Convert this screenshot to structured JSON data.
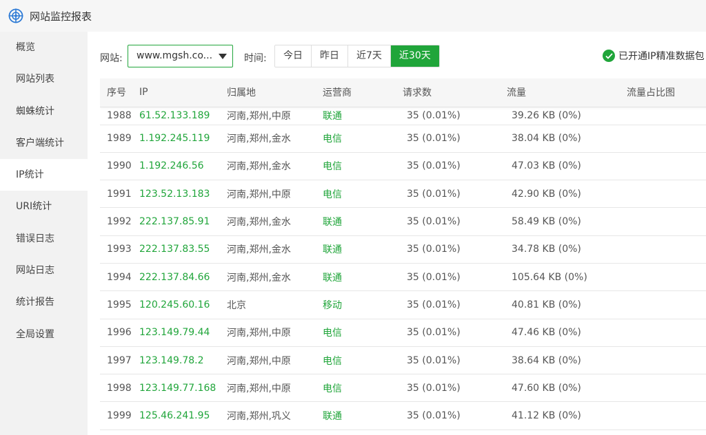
{
  "app": {
    "title": "网站监控报表",
    "logo_icon": "target-globe-icon",
    "accent": "#20a53a"
  },
  "sidebar": {
    "items": [
      {
        "label": "概览",
        "active": false
      },
      {
        "label": "网站列表",
        "active": false
      },
      {
        "label": "蜘蛛统计",
        "active": false
      },
      {
        "label": "客户端统计",
        "active": false
      },
      {
        "label": "IP统计",
        "active": true
      },
      {
        "label": "URI统计",
        "active": false
      },
      {
        "label": "错误日志",
        "active": false
      },
      {
        "label": "网站日志",
        "active": false
      },
      {
        "label": "统计报告",
        "active": false
      },
      {
        "label": "全局设置",
        "active": false
      }
    ]
  },
  "filters": {
    "site_label": "网站:",
    "site_value": "www.mgsh.co...",
    "time_label": "时间:",
    "time_options": [
      "今日",
      "昨日",
      "近7天",
      "近30天"
    ],
    "time_selected": "近30天",
    "ip_pack_text": "已开通IP精准数据包"
  },
  "table": {
    "columns": [
      "序号",
      "IP",
      "归属地",
      "运营商",
      "请求数",
      "流量",
      "流量占比图"
    ],
    "rows": [
      {
        "no": "1988",
        "ip": "61.52.133.189",
        "loc": "河南,郑州,中原",
        "isp": "联通",
        "req": "35 (0.01%)",
        "traffic": "39.26 KB (0%)"
      },
      {
        "no": "1989",
        "ip": "1.192.245.119",
        "loc": "河南,郑州,金水",
        "isp": "电信",
        "req": "35 (0.01%)",
        "traffic": "38.04 KB (0%)"
      },
      {
        "no": "1990",
        "ip": "1.192.246.56",
        "loc": "河南,郑州,金水",
        "isp": "电信",
        "req": "35 (0.01%)",
        "traffic": "47.03 KB (0%)"
      },
      {
        "no": "1991",
        "ip": "123.52.13.183",
        "loc": "河南,郑州,中原",
        "isp": "电信",
        "req": "35 (0.01%)",
        "traffic": "42.90 KB (0%)"
      },
      {
        "no": "1992",
        "ip": "222.137.85.91",
        "loc": "河南,郑州,金水",
        "isp": "联通",
        "req": "35 (0.01%)",
        "traffic": "58.49 KB (0%)"
      },
      {
        "no": "1993",
        "ip": "222.137.83.55",
        "loc": "河南,郑州,金水",
        "isp": "联通",
        "req": "35 (0.01%)",
        "traffic": "34.78 KB (0%)"
      },
      {
        "no": "1994",
        "ip": "222.137.84.66",
        "loc": "河南,郑州,金水",
        "isp": "联通",
        "req": "35 (0.01%)",
        "traffic": "105.64 KB (0%)"
      },
      {
        "no": "1995",
        "ip": "120.245.60.16",
        "loc": "北京",
        "isp": "移动",
        "req": "35 (0.01%)",
        "traffic": "40.81 KB (0%)"
      },
      {
        "no": "1996",
        "ip": "123.149.79.44",
        "loc": "河南,郑州,中原",
        "isp": "电信",
        "req": "35 (0.01%)",
        "traffic": "47.46 KB (0%)"
      },
      {
        "no": "1997",
        "ip": "123.149.78.2",
        "loc": "河南,郑州,中原",
        "isp": "电信",
        "req": "35 (0.01%)",
        "traffic": "38.64 KB (0%)"
      },
      {
        "no": "1998",
        "ip": "123.149.77.168",
        "loc": "河南,郑州,中原",
        "isp": "电信",
        "req": "35 (0.01%)",
        "traffic": "47.60 KB (0%)"
      },
      {
        "no": "1999",
        "ip": "125.46.241.95",
        "loc": "河南,郑州,巩义",
        "isp": "联通",
        "req": "35 (0.01%)",
        "traffic": "41.12 KB (0%)"
      }
    ]
  }
}
